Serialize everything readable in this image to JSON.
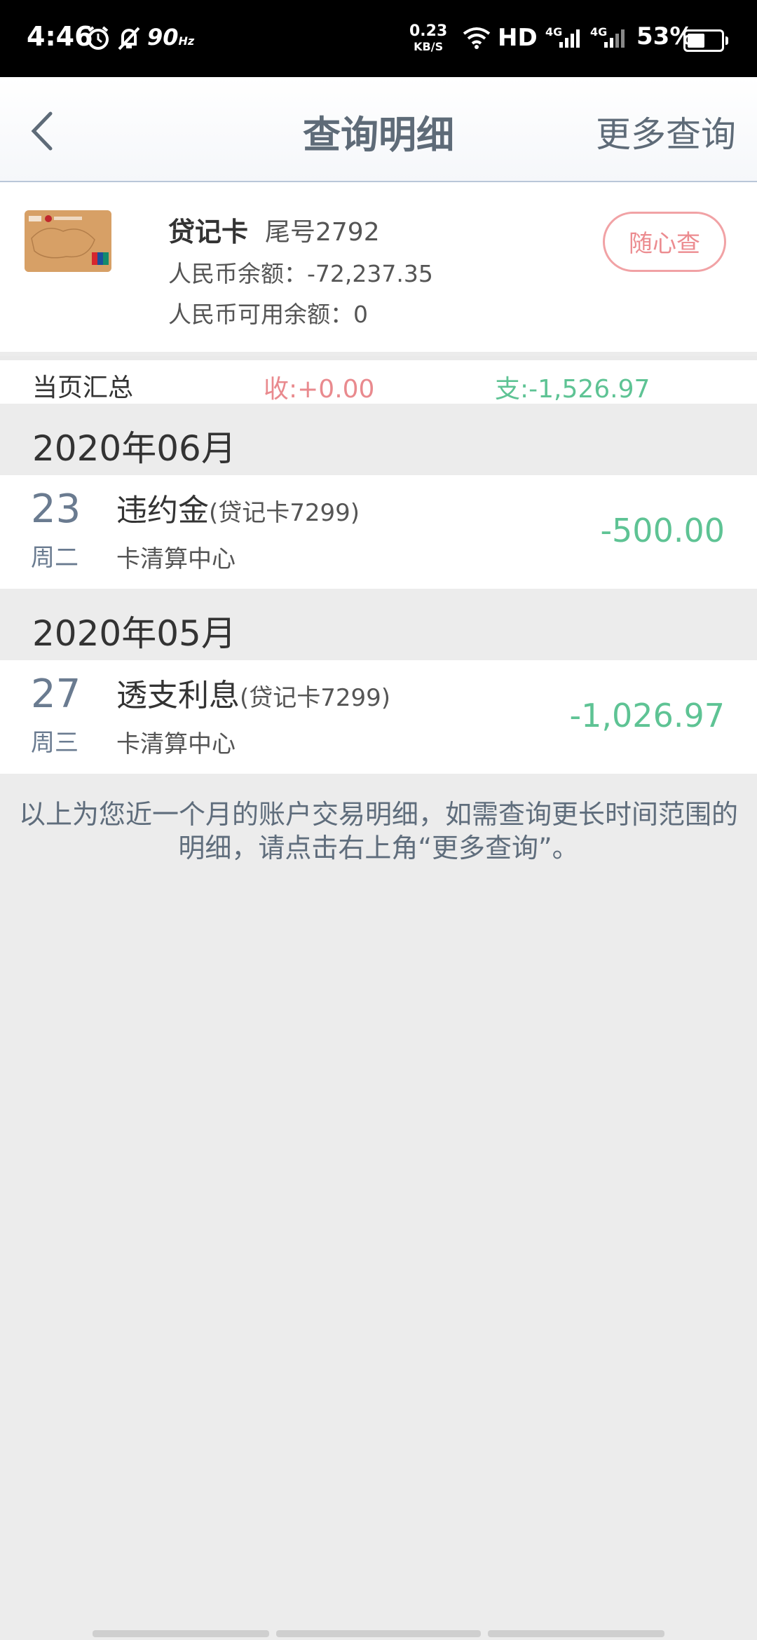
{
  "status_bar": {
    "time": "4:46",
    "hz": "90",
    "hz_unit": "Hz",
    "speed_value": "0.23",
    "speed_unit": "KB/S",
    "hd": "HD",
    "network_1": "4G",
    "network_2": "4G",
    "battery": "53%"
  },
  "header": {
    "title": "查询明细",
    "more_query": "更多查询"
  },
  "card": {
    "name": "贷记卡",
    "tail": "尾号2792",
    "balance": "人民币余额：-72,237.35",
    "available": "人民币可用余额：0",
    "random_query": "随心查"
  },
  "summary": {
    "label": "当页汇总",
    "income": "收:+0.00",
    "expense": "支:-1,526.97"
  },
  "months": [
    {
      "label": "2020年06月",
      "transactions": [
        {
          "day": "23",
          "weekday": "周二",
          "title": "违约金",
          "subtitle": "(贷记卡7299)",
          "org": "卡清算中心",
          "amount": "-500.00"
        }
      ]
    },
    {
      "label": "2020年05月",
      "transactions": [
        {
          "day": "27",
          "weekday": "周三",
          "title": "透支利息",
          "subtitle": "(贷记卡7299)",
          "org": "卡清算中心",
          "amount": "-1,026.97"
        }
      ]
    }
  ],
  "note": "以上为您近一个月的账户交易明细，如需查询更长时间范围的明细，请点击右上角“更多查询”。",
  "colors": {
    "income": "#e98a8e",
    "expense": "#5ec394",
    "title": "#5e6b78"
  }
}
